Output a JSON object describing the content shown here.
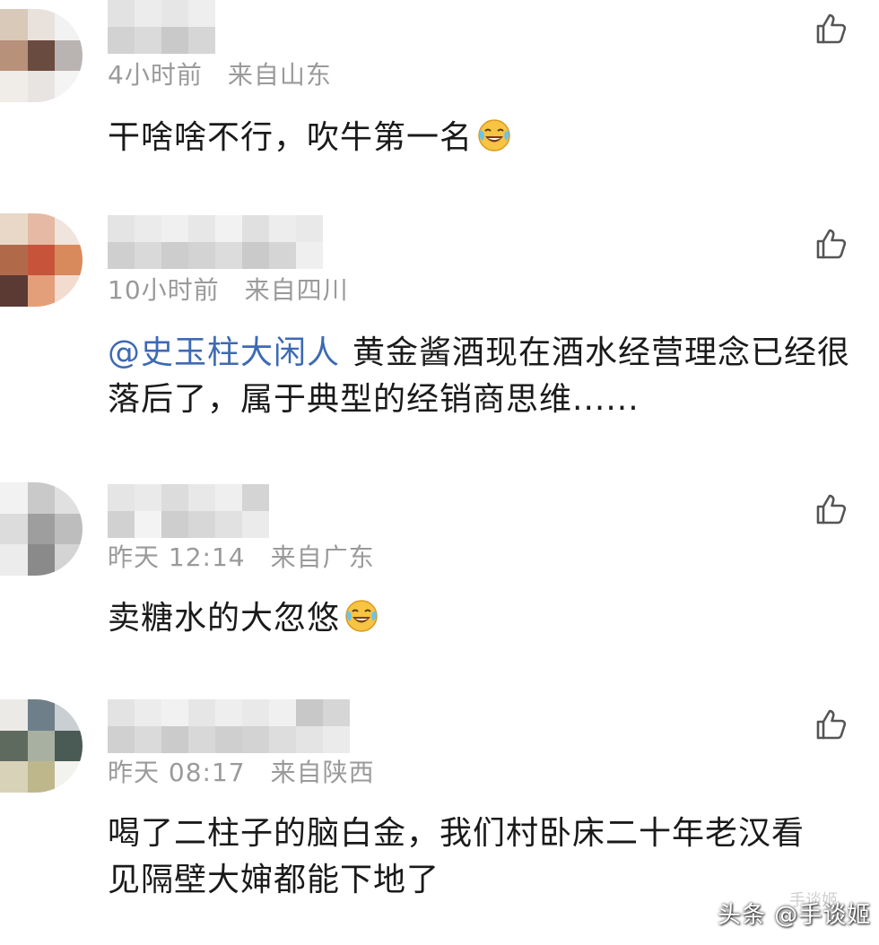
{
  "comments": [
    {
      "time": "4小时前",
      "location": "来自山东",
      "text": "干啥啥不行，吹牛第一名",
      "emoji": "laughing-crying-emoji",
      "avatar_colors": [
        "#d8c9b8",
        "#e9e2dc",
        "#f2f2f2",
        "#b8917a",
        "#6a4b3f",
        "#b9b4b2",
        "#f0ece8",
        "#e8e4e2",
        "#f4f4f4"
      ],
      "name_colors": [
        "#e2e2e2",
        "#d2d2d2",
        "#ececec",
        "#dadada",
        "#e6e6e6",
        "#c9c9c9",
        "#eeeeee",
        "#d6d6d6"
      ]
    },
    {
      "time": "10小时前",
      "location": "来自四川",
      "mention": "@史玉柱大闲人",
      "text": "黄金酱酒现在酒水经营理念已经很落后了，属于典型的经销商思维......",
      "avatar_colors": [
        "#e9d8c8",
        "#e6b9a4",
        "#f1e4dc",
        "#b06a4a",
        "#c8533b",
        "#d98a5c",
        "#5a3a33",
        "#e29f7a",
        "#f2dcd0"
      ],
      "name_colors": [
        "#e4e4e4",
        "#cfcfcf",
        "#ebebeb",
        "#d9d9d9",
        "#f0f0f0",
        "#cdcdcd",
        "#e7e7e7",
        "#d3d3d3",
        "#f2f2f2",
        "#dcdcdc",
        "#e0e0e0",
        "#cacaca",
        "#ededed",
        "#d5d5d5",
        "#e9e9e9",
        "#efefef"
      ]
    },
    {
      "time": "昨天 12:14",
      "location": "来自广东",
      "text": "卖糖水的大忽悠",
      "emoji": "laughing-crying-emoji",
      "avatar_colors": [
        "#f2f2f2",
        "#c9c9c9",
        "#e0e0e0",
        "#dcdcdc",
        "#9e9e9e",
        "#bdbdbd",
        "#ececec",
        "#8a8a8a",
        "#d4d4d4"
      ],
      "name_colors": [
        "#e5e5e5",
        "#d1d1d1",
        "#eaeaea",
        "#f3f3f3",
        "#dcdcdc",
        "#cecece",
        "#e8e8e8",
        "#d7d7d7",
        "#efefef",
        "#e1e1e1",
        "#d4d4d4",
        "#ebebeb"
      ]
    },
    {
      "time": "昨天 08:17",
      "location": "来自陕西",
      "text": "喝了二柱子的脑白金，我们村卧床二十年老汉看见隔壁大婶都能下地了",
      "avatar_colors": [
        "#eceae6",
        "#6f7f8a",
        "#c9cfd2",
        "#5f6a5e",
        "#a8b0a2",
        "#4a5a55",
        "#d8d2b8",
        "#bfb78c",
        "#f2f2ee"
      ],
      "name_colors": [
        "#e3e3e3",
        "#d0d0d0",
        "#ececec",
        "#dadada",
        "#f1f1f1",
        "#cbcbcb",
        "#e6e6e6",
        "#d8d8d8",
        "#eeeeee",
        "#cfcfcf",
        "#e9e9e9",
        "#d3d3d3",
        "#f0f0f0",
        "#dddddd",
        "#c8c8c8",
        "#e4e4e4",
        "#d6d6d6",
        "#ebebeb"
      ]
    }
  ],
  "watermark": {
    "text": "头条 @手谈姬",
    "faint_text": "手谈姬"
  },
  "colors": {
    "mention": "#3d6ab3",
    "meta": "#9a9a9a",
    "body_text": "#1a1a1a"
  },
  "icons": {
    "like": "thumbs-up-outline-icon",
    "emoji": "laughing-crying-emoji"
  }
}
